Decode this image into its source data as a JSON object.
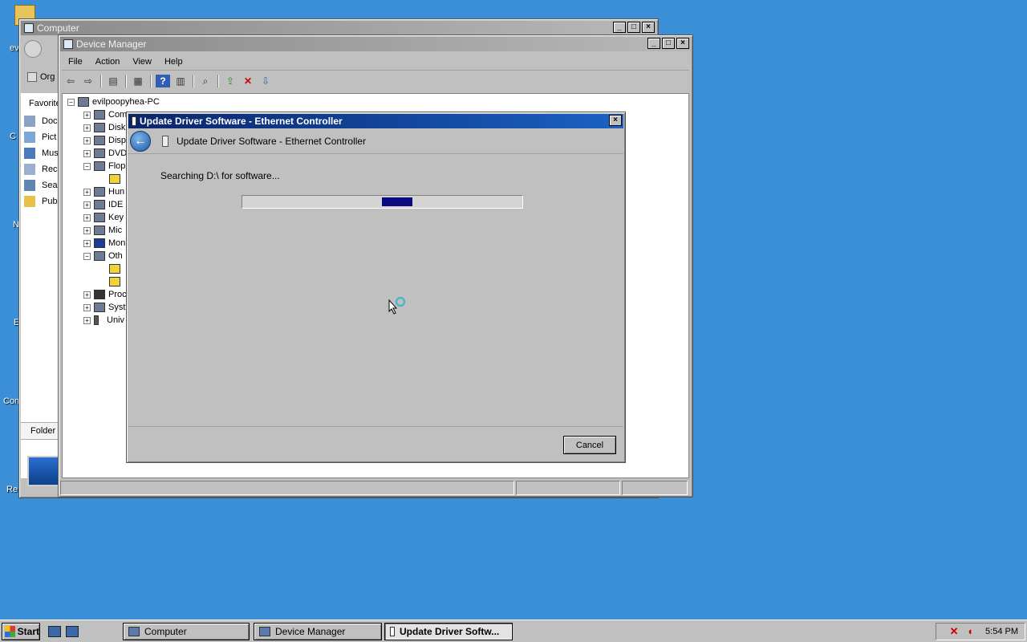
{
  "desktop": {
    "icons": [
      "ev",
      "C",
      "N",
      "E",
      "Con",
      "Re"
    ]
  },
  "computer_window": {
    "title": "Computer",
    "organize_label": "Org",
    "favorites_label": "Favorite",
    "nav_items": [
      "Doc",
      "Pict",
      "Mus",
      "Rec",
      "Sea",
      "Pub"
    ],
    "folders_label": "Folder"
  },
  "device_manager": {
    "title": "Device Manager",
    "menu": [
      "File",
      "Action",
      "View",
      "Help"
    ],
    "root": "evilpoopyhea-PC",
    "tree": [
      "Com",
      "Disk",
      "Disp",
      "DVD",
      "Flop",
      "",
      "Hun",
      "IDE",
      "Key",
      "Mic",
      "Mon",
      "Oth",
      "",
      "",
      "Proc",
      "Syst",
      "Univ"
    ]
  },
  "wizard": {
    "title": "Update Driver Software - Ethernet Controller",
    "header": "Update Driver Software - Ethernet Controller",
    "status": "Searching D:\\ for software...",
    "cancel": "Cancel"
  },
  "taskbar": {
    "start": "Start",
    "tasks": [
      "Computer",
      "Device Manager",
      "Update Driver Softw..."
    ],
    "time": "5:54 PM"
  }
}
